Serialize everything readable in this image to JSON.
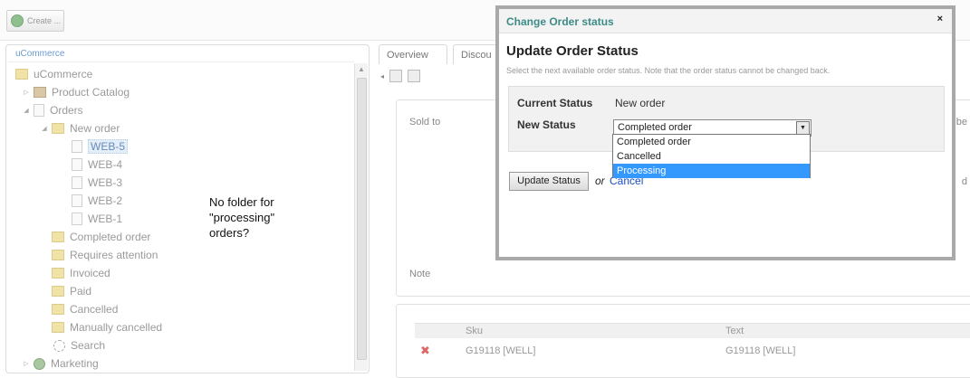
{
  "toolbar": {
    "create_label": "Create ..."
  },
  "tree": {
    "title": "uCommerce",
    "items": [
      {
        "label": "uCommerce"
      },
      {
        "label": "Product Catalog"
      },
      {
        "label": "Orders"
      },
      {
        "label": "New order"
      },
      {
        "label": "WEB-5"
      },
      {
        "label": "WEB-4"
      },
      {
        "label": "WEB-3"
      },
      {
        "label": "WEB-2"
      },
      {
        "label": "WEB-1"
      },
      {
        "label": "Completed order"
      },
      {
        "label": "Requires attention"
      },
      {
        "label": "Invoiced"
      },
      {
        "label": "Paid"
      },
      {
        "label": "Cancelled"
      },
      {
        "label": "Manually cancelled"
      },
      {
        "label": "Search"
      },
      {
        "label": "Marketing"
      }
    ]
  },
  "annotation": {
    "line1": "No folder for",
    "line2": "\"processing\"",
    "line3": "orders?"
  },
  "tabs": [
    "Overview",
    "Discou"
  ],
  "order": {
    "sold_to_label": "Sold to",
    "note_label": "Note",
    "right_label_1": "be",
    "right_label_2": "d"
  },
  "lines": {
    "headers": [
      "Sku",
      "Text"
    ],
    "rows": [
      {
        "sku": "G19118 [WELL]",
        "text": "G19118 [WELL]"
      }
    ]
  },
  "modal": {
    "title": "Change Order status",
    "close": "×",
    "heading": "Update Order Status",
    "description": "Select the next available order status. Note that the order status cannot be changed back.",
    "current_label": "Current Status",
    "current_value": "New order",
    "new_label": "New Status",
    "selected": "Completed order",
    "options": [
      "Completed order",
      "Cancelled",
      "Processing"
    ],
    "highlighted_option": "Processing",
    "button": "Update Status",
    "or_text": "or",
    "cancel": "Cancel"
  }
}
